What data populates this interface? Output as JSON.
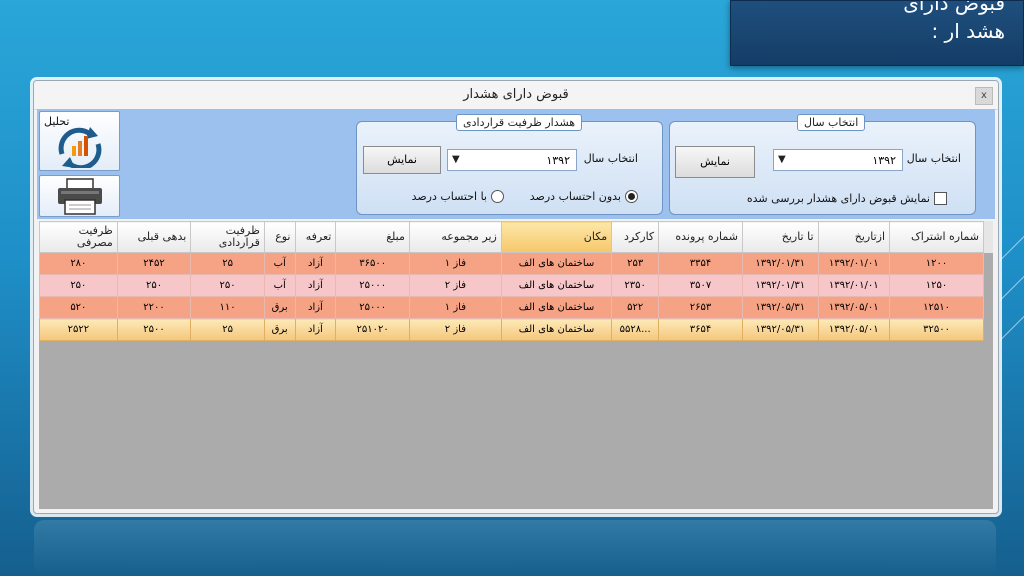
{
  "slide": {
    "title_line1": "قبوض دارای",
    "title_line2": "هشد ار :"
  },
  "window": {
    "title": "قبوض دارای هشدار",
    "close": "x"
  },
  "toolbar": {
    "analysis_label": "تحلیل"
  },
  "contract_group": {
    "legend": "هشدار ظرفیت قراردادی",
    "year_label": "انتخاب سال",
    "year_value": "۱۳۹۲",
    "show_button": "نمایش",
    "option_without": "بدون احتساب درصد",
    "option_with": "با احتساب درصد"
  },
  "year_group": {
    "legend": "انتخاب سال",
    "year_label": "انتخاب سال",
    "year_value": "۱۳۹۲",
    "show_button": "نمایش",
    "checkbox_label": "نمایش قبوض دارای هشدار بررسی شده"
  },
  "table": {
    "columns": [
      "شماره اشتراک",
      "ازتاریخ",
      "تا تاریخ",
      "شماره پرونده",
      "کارکرد",
      "مکان",
      "زیر مجموعه",
      "مبلغ",
      "تعرفه",
      "نوع",
      "ظرفیت قراردادی",
      "بدهی قبلی",
      "ظرفیت مصرفی"
    ],
    "rows": [
      [
        "۱۲۰۰",
        "۱۳۹۲/۰۱/۰۱",
        "۱۳۹۲/۰۱/۳۱",
        "۳۳۵۴",
        "۲۵۳",
        "ساختمان های الف",
        "فاز ۱",
        "۳۶۵۰۰",
        "آزاد",
        "آب",
        "۲۵",
        "۲۴۵۲",
        "۲۸۰"
      ],
      [
        "۱۲۵۰",
        "۱۳۹۲/۰۱/۰۱",
        "۱۳۹۲/۰۱/۳۱",
        "۳۵۰۷",
        "۲۳۵۰",
        "ساختمان های الف",
        "فاز ۲",
        "۲۵۰۰۰",
        "آزاد",
        "آب",
        "۲۵۰",
        "۲۵۰",
        "۲۵۰"
      ],
      [
        "۱۲۵۱۰",
        "۱۳۹۲/۰۵/۰۱",
        "۱۳۹۲/۰۵/۳۱",
        "۲۶۵۳",
        "۵۲۲",
        "ساختمان های الف",
        "فاز ۱",
        "۲۵۰۰۰",
        "آزاد",
        "برق",
        "۱۱۰",
        "۲۲۰۰",
        "۵۲۰"
      ],
      [
        "۳۲۵۰۰",
        "۱۳۹۲/۰۵/۰۱",
        "۱۳۹۲/۰۵/۳۱",
        "۳۶۵۴",
        "...۵۵۲۸",
        "ساختمان های الف",
        "فاز ۲",
        "۲۵۱۰۲۰",
        "آزاد",
        "برق",
        "۲۵",
        "۲۵۰۰",
        "۲۵۲۲"
      ]
    ]
  }
}
